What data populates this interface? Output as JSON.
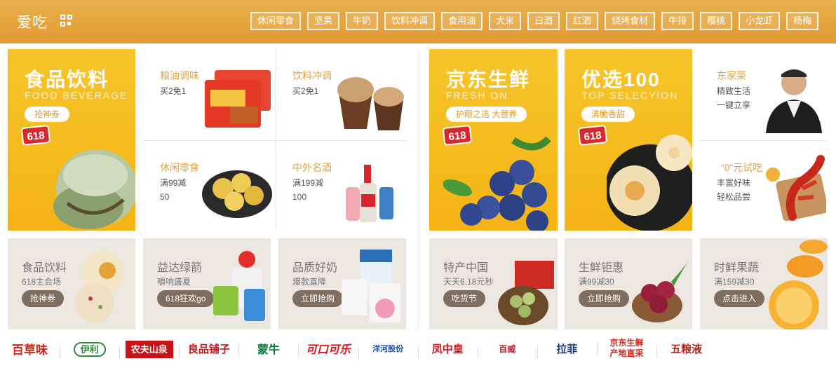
{
  "header": {
    "brand": "爱吃",
    "tags": [
      "休闲零食",
      "坚果",
      "牛奶",
      "饮料冲调",
      "食用油",
      "大米",
      "白酒",
      "红酒",
      "烧烤食材",
      "牛排",
      "樱桃",
      "小龙虾",
      "杨梅"
    ]
  },
  "left_promo": {
    "title": "食品饮料",
    "subtitle": "FOOD BEVERAGE",
    "button": "抢神券",
    "badge": "618"
  },
  "left_grid": [
    {
      "title": "粮油调味",
      "sub": "买2免1"
    },
    {
      "title": "饮料冲调",
      "sub": "买2免1"
    },
    {
      "title": "休闲零食",
      "sub": "满99减\n50"
    },
    {
      "title": "中外名酒",
      "sub": "满199减\n100"
    }
  ],
  "fresh_promo": {
    "title": "京东生鲜",
    "subtitle": "FRESH ON",
    "button": "护眼之选 大营养",
    "badge": "618"
  },
  "select_promo": {
    "title": "优选100",
    "subtitle": "TOP SELECYION",
    "button": "清脆香甜",
    "badge": "618"
  },
  "right_cells": [
    {
      "title": "东家菜",
      "sub": "精致生活\n一键立享"
    },
    {
      "title": "“0”元试吃",
      "sub": "丰富好味\n轻松品尝"
    }
  ],
  "bottom_tiles": [
    {
      "title": "食品饮料",
      "sub": "618主会场",
      "button": "抢神券"
    },
    {
      "title": "益达绿箭",
      "sub": "嚼响盛夏",
      "button": "618狂欢go"
    },
    {
      "title": "品质好奶",
      "sub": "爆款直降",
      "button": "立即抢购"
    },
    {
      "title": "特产中国",
      "sub": "天天6.18元秒",
      "button": "吃货节"
    },
    {
      "title": "生鲜钜惠",
      "sub": "满99减30",
      "button": "立即抢购"
    },
    {
      "title": "时鲜果蔬",
      "sub": "满159减30",
      "button": "点击进入"
    }
  ],
  "brands": [
    {
      "name": "百草味",
      "color": "#d0261c"
    },
    {
      "name": "伊利",
      "color": "#2a8f3d"
    },
    {
      "name": "农夫山泉",
      "color": "#c7141a"
    },
    {
      "name": "良品铺子",
      "color": "#c8161d"
    },
    {
      "name": "蒙牛",
      "color": "#0a7a3b"
    },
    {
      "name": "可口可乐",
      "color": "#e0141e"
    },
    {
      "name": "洋河股份",
      "color": "#1a4fa0"
    },
    {
      "name": "凤中皇",
      "color": "#c8161d"
    },
    {
      "name": "百威",
      "color": "#c8161d"
    },
    {
      "name": "拉菲",
      "color": "#1d3a7a"
    },
    {
      "name": "京东生鲜\n产地直采",
      "color": "#d0261c"
    },
    {
      "name": "五粮液",
      "color": "#b0261c"
    }
  ]
}
